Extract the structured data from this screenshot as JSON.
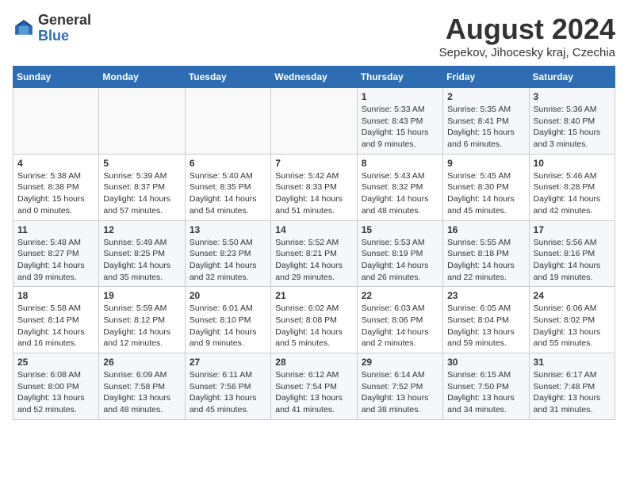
{
  "logo": {
    "general": "General",
    "blue": "Blue"
  },
  "header": {
    "title": "August 2024",
    "subtitle": "Sepekov, Jihocesky kraj, Czechia"
  },
  "weekdays": [
    "Sunday",
    "Monday",
    "Tuesday",
    "Wednesday",
    "Thursday",
    "Friday",
    "Saturday"
  ],
  "weeks": [
    [
      {
        "day": "",
        "info": ""
      },
      {
        "day": "",
        "info": ""
      },
      {
        "day": "",
        "info": ""
      },
      {
        "day": "",
        "info": ""
      },
      {
        "day": "1",
        "info": "Sunrise: 5:33 AM\nSunset: 8:43 PM\nDaylight: 15 hours\nand 9 minutes."
      },
      {
        "day": "2",
        "info": "Sunrise: 5:35 AM\nSunset: 8:41 PM\nDaylight: 15 hours\nand 6 minutes."
      },
      {
        "day": "3",
        "info": "Sunrise: 5:36 AM\nSunset: 8:40 PM\nDaylight: 15 hours\nand 3 minutes."
      }
    ],
    [
      {
        "day": "4",
        "info": "Sunrise: 5:38 AM\nSunset: 8:38 PM\nDaylight: 15 hours\nand 0 minutes."
      },
      {
        "day": "5",
        "info": "Sunrise: 5:39 AM\nSunset: 8:37 PM\nDaylight: 14 hours\nand 57 minutes."
      },
      {
        "day": "6",
        "info": "Sunrise: 5:40 AM\nSunset: 8:35 PM\nDaylight: 14 hours\nand 54 minutes."
      },
      {
        "day": "7",
        "info": "Sunrise: 5:42 AM\nSunset: 8:33 PM\nDaylight: 14 hours\nand 51 minutes."
      },
      {
        "day": "8",
        "info": "Sunrise: 5:43 AM\nSunset: 8:32 PM\nDaylight: 14 hours\nand 48 minutes."
      },
      {
        "day": "9",
        "info": "Sunrise: 5:45 AM\nSunset: 8:30 PM\nDaylight: 14 hours\nand 45 minutes."
      },
      {
        "day": "10",
        "info": "Sunrise: 5:46 AM\nSunset: 8:28 PM\nDaylight: 14 hours\nand 42 minutes."
      }
    ],
    [
      {
        "day": "11",
        "info": "Sunrise: 5:48 AM\nSunset: 8:27 PM\nDaylight: 14 hours\nand 39 minutes."
      },
      {
        "day": "12",
        "info": "Sunrise: 5:49 AM\nSunset: 8:25 PM\nDaylight: 14 hours\nand 35 minutes."
      },
      {
        "day": "13",
        "info": "Sunrise: 5:50 AM\nSunset: 8:23 PM\nDaylight: 14 hours\nand 32 minutes."
      },
      {
        "day": "14",
        "info": "Sunrise: 5:52 AM\nSunset: 8:21 PM\nDaylight: 14 hours\nand 29 minutes."
      },
      {
        "day": "15",
        "info": "Sunrise: 5:53 AM\nSunset: 8:19 PM\nDaylight: 14 hours\nand 26 minutes."
      },
      {
        "day": "16",
        "info": "Sunrise: 5:55 AM\nSunset: 8:18 PM\nDaylight: 14 hours\nand 22 minutes."
      },
      {
        "day": "17",
        "info": "Sunrise: 5:56 AM\nSunset: 8:16 PM\nDaylight: 14 hours\nand 19 minutes."
      }
    ],
    [
      {
        "day": "18",
        "info": "Sunrise: 5:58 AM\nSunset: 8:14 PM\nDaylight: 14 hours\nand 16 minutes."
      },
      {
        "day": "19",
        "info": "Sunrise: 5:59 AM\nSunset: 8:12 PM\nDaylight: 14 hours\nand 12 minutes."
      },
      {
        "day": "20",
        "info": "Sunrise: 6:01 AM\nSunset: 8:10 PM\nDaylight: 14 hours\nand 9 minutes."
      },
      {
        "day": "21",
        "info": "Sunrise: 6:02 AM\nSunset: 8:08 PM\nDaylight: 14 hours\nand 5 minutes."
      },
      {
        "day": "22",
        "info": "Sunrise: 6:03 AM\nSunset: 8:06 PM\nDaylight: 14 hours\nand 2 minutes."
      },
      {
        "day": "23",
        "info": "Sunrise: 6:05 AM\nSunset: 8:04 PM\nDaylight: 13 hours\nand 59 minutes."
      },
      {
        "day": "24",
        "info": "Sunrise: 6:06 AM\nSunset: 8:02 PM\nDaylight: 13 hours\nand 55 minutes."
      }
    ],
    [
      {
        "day": "25",
        "info": "Sunrise: 6:08 AM\nSunset: 8:00 PM\nDaylight: 13 hours\nand 52 minutes."
      },
      {
        "day": "26",
        "info": "Sunrise: 6:09 AM\nSunset: 7:58 PM\nDaylight: 13 hours\nand 48 minutes."
      },
      {
        "day": "27",
        "info": "Sunrise: 6:11 AM\nSunset: 7:56 PM\nDaylight: 13 hours\nand 45 minutes."
      },
      {
        "day": "28",
        "info": "Sunrise: 6:12 AM\nSunset: 7:54 PM\nDaylight: 13 hours\nand 41 minutes."
      },
      {
        "day": "29",
        "info": "Sunrise: 6:14 AM\nSunset: 7:52 PM\nDaylight: 13 hours\nand 38 minutes."
      },
      {
        "day": "30",
        "info": "Sunrise: 6:15 AM\nSunset: 7:50 PM\nDaylight: 13 hours\nand 34 minutes."
      },
      {
        "day": "31",
        "info": "Sunrise: 6:17 AM\nSunset: 7:48 PM\nDaylight: 13 hours\nand 31 minutes."
      }
    ]
  ]
}
